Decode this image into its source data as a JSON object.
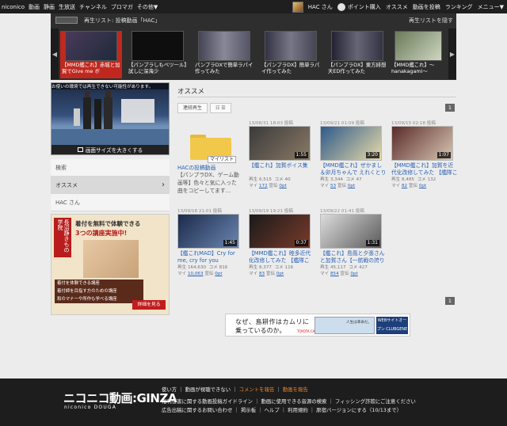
{
  "topbar": {
    "nav": [
      "niconico",
      "動画",
      "静画",
      "生放送",
      "チャンネル",
      "ブロマガ",
      "その他▼"
    ],
    "user": "HAC さん",
    "points": "ポイント購入",
    "links": [
      "オススメ",
      "動画を投稿",
      "ランキング",
      "メニュー▼"
    ]
  },
  "playlist": {
    "label": "再生リスト: 投稿動画「HAC」",
    "hide": "再生リストを隠す",
    "items": [
      {
        "title": "【MMD艦これ】赤城と加賀でGive me ボ"
      },
      {
        "title": "【パンプラしもベツール】試しに深海少"
      },
      {
        "title": "パンプラDXで簡単ラパイ作ってみた"
      },
      {
        "title": "【パンプラDX】簡単ラパイ作ってみた"
      },
      {
        "title": "【パンプラDX】東方緋想天ED作ってみた"
      },
      {
        "title": "【MMD艦これ】～hanakagami～"
      }
    ]
  },
  "player": {
    "overlay_text": "お使いの環境では再生できない可能性があります。",
    "resize_label": "画面サイズを大きくする"
  },
  "sidebar": {
    "items": [
      "検索",
      "オススメ",
      "HAC さん"
    ]
  },
  "ad": {
    "headline": "着付を無料で体験できる",
    "sub": "3つの講座実施中!",
    "vertical": "長沼静きもの学院",
    "bullets": [
      "着付を体験できる講座",
      "着付師を目指す方のための講座",
      "和のマナーや所作も学べる講座"
    ],
    "cta": "詳細を見る"
  },
  "main": {
    "title": "オススメ",
    "play_all": "連続再生",
    "page": "1",
    "mylist": {
      "badge": "マイリスト",
      "title": "HACの投稿動画",
      "desc": "【パンプラDX、ゲーム動画等】色々と気に入った曲をコピーしてます…"
    },
    "videos": [
      {
        "date": "13/08/31 18:03 投稿",
        "title": "【艦これ】加賀ボイス集",
        "duration": "1:55",
        "plays": "再生 6,515",
        "comments": "コメ 40",
        "mylists": "172",
        "ad_pts": "0pt"
      },
      {
        "date": "13/09/21 01:09 投稿",
        "title": "【MMD艦これ】ぜかまし＆卯月ちゃんで えれくとり",
        "duration": "3:20",
        "plays": "再生 3,344",
        "comments": "コメ 47",
        "mylists": "53",
        "ad_pts": "0pt"
      },
      {
        "date": "13/09/15 02:18 投稿",
        "title": "【MMD艦これ】加賀を近代化改修してみた 【艦隊こ",
        "duration": "1:07",
        "plays": "再生 8,485",
        "comments": "コメ 132",
        "mylists": "82",
        "ad_pts": "0pt"
      },
      {
        "date": "13/09/18 21:01 投稿",
        "title": "【艦これMAD】Cry for me, cry for you",
        "duration": "1:45",
        "plays": "再生 164,630",
        "comments": "コメ 816",
        "mylists": "10,063",
        "ad_pts": "0pt"
      },
      {
        "date": "13/09/19 19:21 投稿",
        "title": "【MMD艦これ】睦多近代化改修してみた 【艦隊こ",
        "duration": "0:37",
        "plays": "再生 8,377",
        "comments": "コメ 116",
        "mylists": "83",
        "ad_pts": "0pt"
      },
      {
        "date": "13/09/22 01:41 投稿",
        "title": "【艦これ】島風と夕張さんと加賀さん【一航戦の誇り",
        "duration": "1:31",
        "plays": "再生 45,117",
        "comments": "コメ 427",
        "mylists": "854",
        "ad_pts": "0pt"
      }
    ]
  },
  "banner": {
    "line1": "なぜ、島耕作はカムリに",
    "line2": "乗っているのか。",
    "brand": "TOYOTA CAMRY",
    "clip": "人生は革命だ。",
    "cta": "WEBサイトオープン CLUBGENE"
  },
  "footer": {
    "logo": "ニコニコ動画:GINZA",
    "logo_sub": "niconico DOUGA",
    "line1": [
      "使い方",
      "動画が視聴できない",
      "コメントを報告",
      "動画を報告"
    ],
    "line2": "権利侵害に関する動画投稿ガイドライン ｜ 動画に使用できる音源の検索 ｜ フィッシング詐欺にご注意ください",
    "line3": "広告出稿に関するお問い合わせ ｜ 掲示板 ｜ ヘルプ ｜ 利用規約 ｜ 原宿バージョンにする（10/13まで）"
  }
}
